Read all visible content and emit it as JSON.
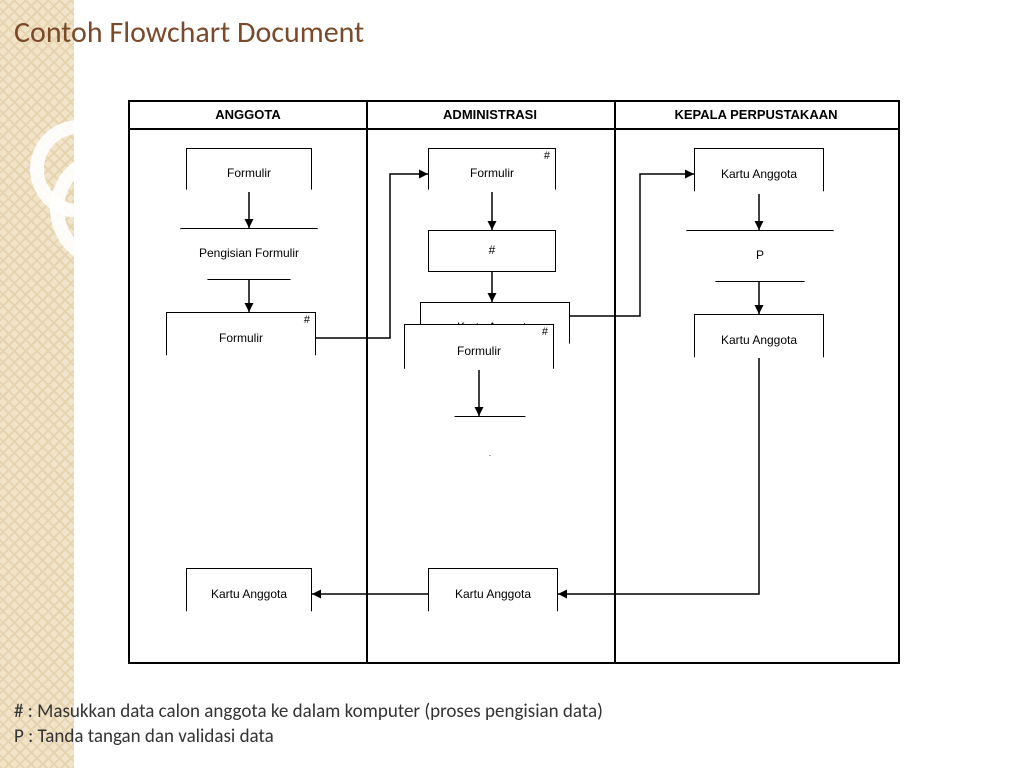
{
  "title": "Contoh Flowchart Document",
  "lanes": {
    "anggota": "ANGGOTA",
    "administrasi": "ADMINISTRASI",
    "kepala": "KEPALA PERPUSTAKAAN"
  },
  "nodes": {
    "a_form1": "Formulir",
    "a_manual": "Pengisian Formulir",
    "a_form2": "Formulir",
    "a_kartu": "Kartu Anggota",
    "b_form1": "Formulir",
    "b_proc": "#",
    "b_kartuA": "Kartu Anggota",
    "b_form2": "Formulir",
    "b_kartuB": "Kartu Anggota",
    "c_kartu1": "Kartu Anggota",
    "c_manual": "P",
    "c_kartu2": "Kartu Anggota"
  },
  "hash_mark": "#",
  "legend": {
    "hash": "# : Masukkan data calon anggota ke dalam komputer (proses pengisian data)",
    "p": "P : Tanda tangan dan validasi data"
  }
}
